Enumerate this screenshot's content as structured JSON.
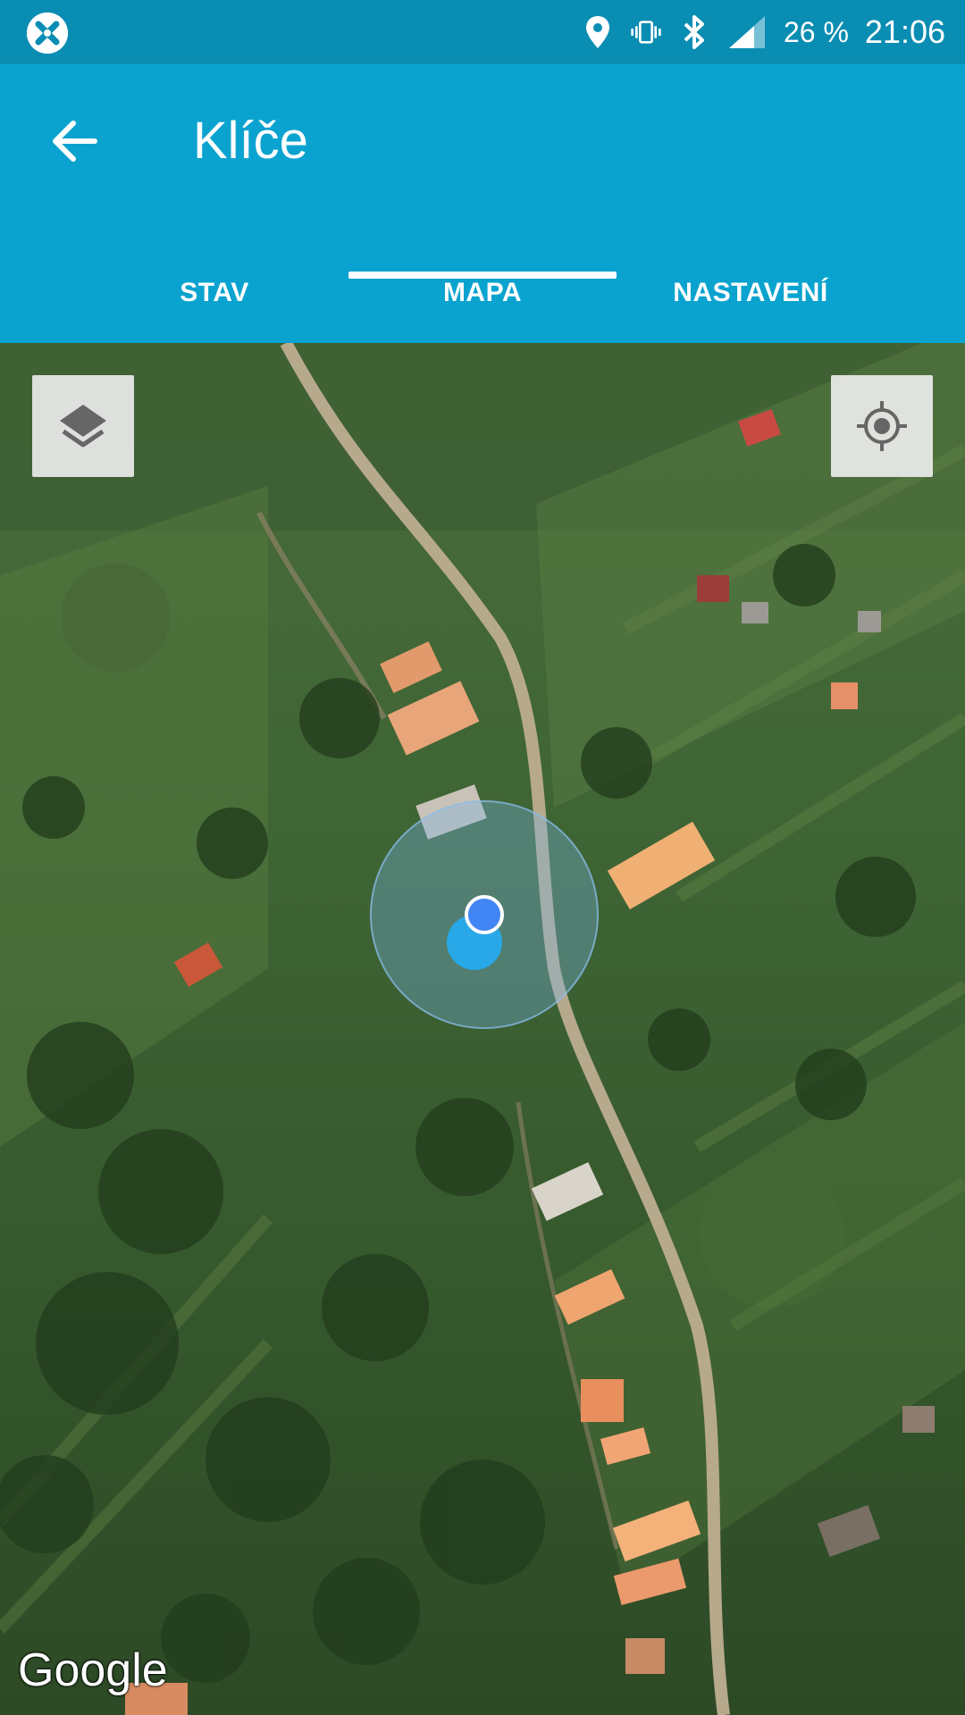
{
  "status_bar": {
    "battery": "26 %",
    "time": "21:06",
    "icons": [
      "app-notification-icon",
      "location-icon",
      "vibrate-icon",
      "bluetooth-icon",
      "signal-icon"
    ]
  },
  "app_bar": {
    "title": "Klíče",
    "back_icon": "arrow-back-icon",
    "color": "#0aa3cf"
  },
  "tabs": [
    {
      "label": "STAV",
      "selected": false
    },
    {
      "label": "MAPA",
      "selected": true
    },
    {
      "label": "NASTAVENÍ",
      "selected": false
    }
  ],
  "map": {
    "type": "satellite",
    "attribution": "Google",
    "controls": [
      "layers-icon",
      "my-location-icon"
    ]
  }
}
